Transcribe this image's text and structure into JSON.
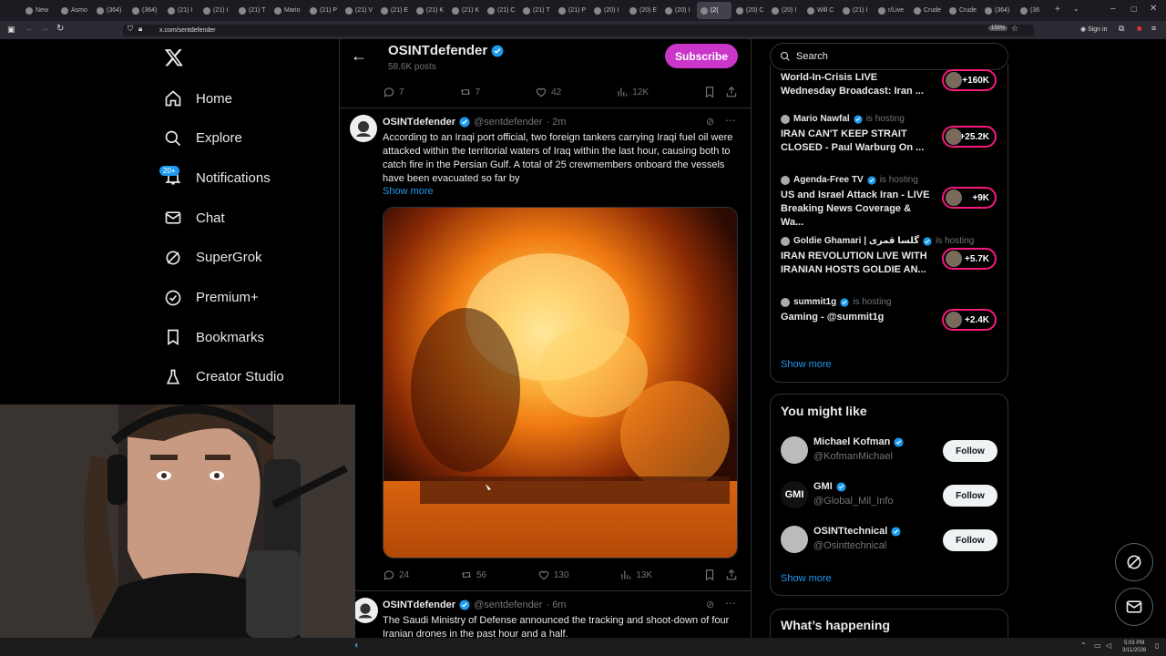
{
  "browser": {
    "tabs": [
      {
        "label": "New"
      },
      {
        "label": "Asmo"
      },
      {
        "label": "(364)"
      },
      {
        "label": "(364)"
      },
      {
        "label": "(21) I"
      },
      {
        "label": "(21) I"
      },
      {
        "label": "(21) T"
      },
      {
        "label": "Mario"
      },
      {
        "label": "(21) P"
      },
      {
        "label": "(21) V"
      },
      {
        "label": "(21) E"
      },
      {
        "label": "(21) K"
      },
      {
        "label": "(21) K"
      },
      {
        "label": "(21) C"
      },
      {
        "label": "(21) T"
      },
      {
        "label": "(21) P"
      },
      {
        "label": "(20) I"
      },
      {
        "label": "(20) E"
      },
      {
        "label": "(20) I"
      },
      {
        "label": "(2(",
        "active": true
      },
      {
        "label": "(20) C"
      },
      {
        "label": "(20) I"
      },
      {
        "label": "Will C"
      },
      {
        "label": "(21) I"
      },
      {
        "label": "r/Live"
      },
      {
        "label": "Crude"
      },
      {
        "label": "Crude"
      },
      {
        "label": "(364)"
      },
      {
        "label": "(36"
      }
    ],
    "url": "x.com/sentdefender",
    "zoom": "150%",
    "sign_in": "Sign in"
  },
  "nav": {
    "items": [
      {
        "label": "Home",
        "icon": "home-icon"
      },
      {
        "label": "Explore",
        "icon": "search-icon"
      },
      {
        "label": "Notifications",
        "icon": "bell-icon"
      },
      {
        "label": "Chat",
        "icon": "mail-icon"
      },
      {
        "label": "SuperGrok",
        "icon": "grok-icon"
      },
      {
        "label": "Premium+",
        "icon": "verified-icon"
      },
      {
        "label": "Bookmarks",
        "icon": "bookmark-icon"
      },
      {
        "label": "Creator Studio",
        "icon": "flask-icon"
      }
    ],
    "notif_badge": "20+"
  },
  "profile_header": {
    "name": "OSINTdefender",
    "posts": "58.6K posts",
    "subscribe": "Subscribe"
  },
  "tweet0_actions": {
    "replies": "7",
    "reposts": "7",
    "likes": "42",
    "views": "12K"
  },
  "tweet1": {
    "name": "OSINTdefender",
    "handle": "@sentdefender",
    "time": "· 2m",
    "text": "According to an Iraqi port official, two foreign tankers carrying Iraqi fuel oil were attacked within the territorial waters of Iraq within the last hour, causing both to catch fire in the Persian Gulf. A total of 25 crewmembers onboard the vessels have been evacuated so far by",
    "show_more": "Show more",
    "replies": "24",
    "reposts": "56",
    "likes": "130",
    "views": "13K"
  },
  "tweet2": {
    "name": "OSINTdefender",
    "handle": "@sentdefender",
    "time": "· 6m",
    "text": "The Saudi Ministry of Defense announced the tracking and shoot-down of four Iranian drones in the past hour and a half."
  },
  "search": {
    "placeholder": "Search"
  },
  "spaces": [
    {
      "host": "",
      "title": "World-In-Crisis LIVE Wednesday Broadcast: Iran ...",
      "count": "+160K"
    },
    {
      "host": "Mario Nawfal",
      "hosting": "is hosting",
      "title": "IRAN CAN'T KEEP STRAIT CLOSED - Paul Warburg On ...",
      "count": "+25.2K"
    },
    {
      "host": "Agenda-Free TV",
      "hosting": "is hosting",
      "title": "US and Israel Attack Iran - LIVE Breaking News Coverage & Wa...",
      "count": "+9K"
    },
    {
      "host": "Goldie Ghamari | گلسا قمری",
      "hosting": "is hosting",
      "title": "IRAN REVOLUTION LIVE WITH IRANIAN HOSTS GOLDIE AN...",
      "count": "+5.7K"
    },
    {
      "host": "summit1g",
      "hosting": "is hosting",
      "title": "Gaming - @summit1g",
      "count": "+2.4K"
    }
  ],
  "spaces_show_more": "Show more",
  "might_like": {
    "title": "You might like",
    "users": [
      {
        "name": "Michael Kofman",
        "handle": "@KofmanMichael",
        "btn": "Follow"
      },
      {
        "name": "GMI",
        "handle": "@Global_Mil_Info",
        "btn": "Follow",
        "logo": "GMI"
      },
      {
        "name": "OSINTtechnical",
        "handle": "@Osinttechnical",
        "btn": "Follow"
      }
    ],
    "show_more": "Show more"
  },
  "whats_happening": "What’s happening",
  "clock": {
    "time": "5:03 PM",
    "date": "3/11/2026"
  },
  "colors": {
    "accent": "#1d9bf0",
    "subscribe": "#c936c9",
    "live": "#f91880"
  }
}
